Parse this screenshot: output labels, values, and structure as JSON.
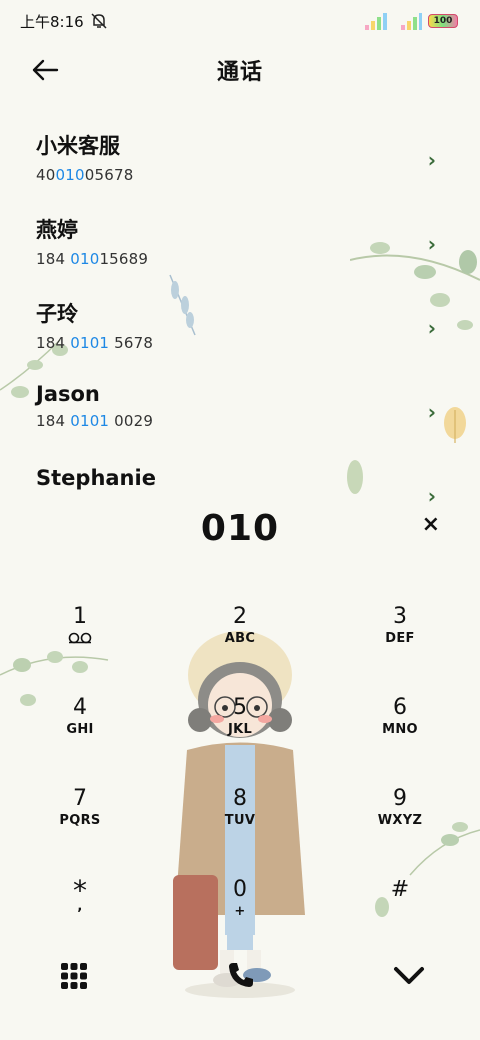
{
  "status_bar": {
    "time": "上午8:16",
    "battery": "100",
    "icons": [
      "mute-bell-icon",
      "signal-icon",
      "wifi-icon",
      "battery-icon"
    ]
  },
  "header": {
    "title": "通话",
    "back_icon": "arrow-left-icon"
  },
  "contacts": [
    {
      "name": "小米客服",
      "num_pre": "40",
      "num_hl": "010",
      "num_post": "05678"
    },
    {
      "name": "燕婷",
      "num_pre": "184 ",
      "num_hl": "010",
      "num_post": "15689"
    },
    {
      "name": "子玲",
      "num_pre": "184 ",
      "num_hl": "0101",
      "num_post": " 5678"
    },
    {
      "name": "Jason",
      "num_pre": "184 ",
      "num_hl": "0101",
      "num_post": " 0029"
    },
    {
      "name": "Stephanie",
      "num_pre": "",
      "num_hl": "",
      "num_post": ""
    }
  ],
  "dialer": {
    "number": "010",
    "clear_label": "×"
  },
  "keypad": [
    {
      "digit": "1",
      "letters": "",
      "icon": "voicemail-icon"
    },
    {
      "digit": "2",
      "letters": "ABC"
    },
    {
      "digit": "3",
      "letters": "DEF"
    },
    {
      "digit": "4",
      "letters": "GHI"
    },
    {
      "digit": "5",
      "letters": "JKL"
    },
    {
      "digit": "6",
      "letters": "MNO"
    },
    {
      "digit": "7",
      "letters": "PQRS"
    },
    {
      "digit": "8",
      "letters": "TUV"
    },
    {
      "digit": "9",
      "letters": "WXYZ"
    },
    {
      "digit": "*",
      "letters": ","
    },
    {
      "digit": "0",
      "letters": "+"
    },
    {
      "digit": "#",
      "letters": ""
    }
  ],
  "bottom_bar": {
    "icons": [
      "keypad-grid-icon",
      "phone-call-icon",
      "chevron-down-icon"
    ]
  },
  "colors": {
    "highlight": "#1e88e5",
    "background": "#f8f8f2",
    "chevron": "#3a6b3a"
  }
}
